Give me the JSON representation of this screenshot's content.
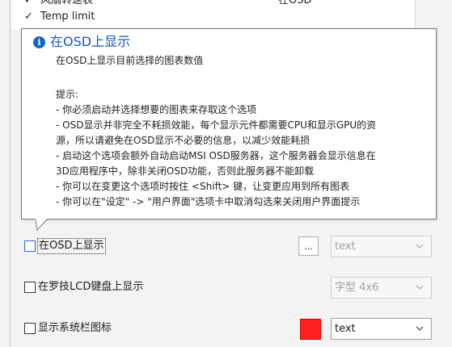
{
  "list": {
    "rows": [
      {
        "name": "风扇转速表",
        "value": "在OSD"
      },
      {
        "name": "Temp limit",
        "value": ""
      }
    ]
  },
  "tooltip": {
    "title": "在OSD上显示",
    "subtitle": "在OSD上显示目前选择的图表数值",
    "lines": [
      "提示:",
      "- 你必须启动并选择想要的图表来存取这个选项",
      "- OSD显示并非完全不耗损效能，每个显示元件都需要CPU和显示GPU的资",
      "源，所以请避免在OSD显示不必要的信息，以减少效能耗损",
      "- 启动这个选项会额外自动启动MSI OSD服务器，这个服务器会显示信息在",
      "3D应用程序中，除非关闭OSD功能，否则此服务器不能卸载",
      "- 你可以在变更这个选项时按住 <Shift> 键，让变更应用到所有图表",
      "- 你可以在\"设定\" -> \"用户界面\"选项卡中取消勾选来关闭用户界面提示"
    ]
  },
  "options": {
    "osd": {
      "label": "在OSD上显示",
      "button_label": "...",
      "dropdown_value": "text"
    },
    "lcd": {
      "label": "在罗技LCD键盘上显示",
      "dropdown_value": "字型 4x6"
    },
    "tray": {
      "label": "显示系统栏图标",
      "dropdown_value": "text",
      "swatch_color": "#ff1f1f"
    }
  }
}
